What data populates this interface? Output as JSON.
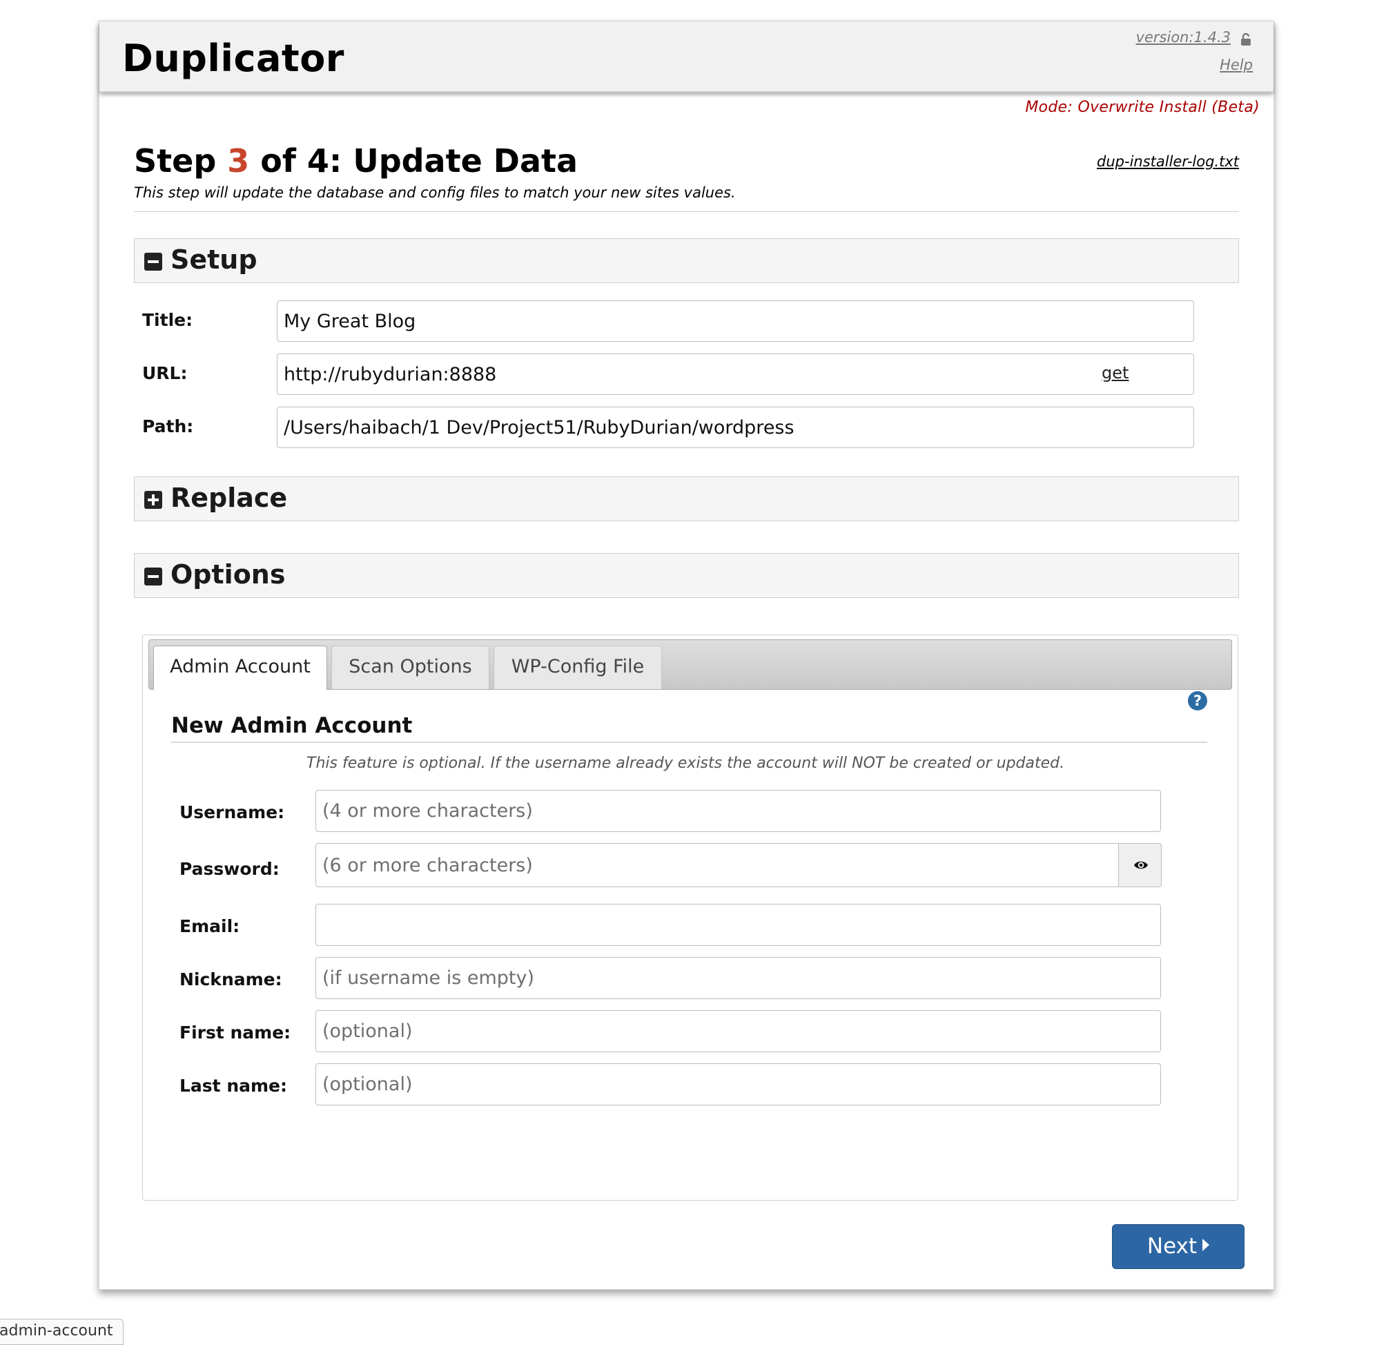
{
  "header": {
    "app_title": "Duplicator",
    "version": "version:1.4.3",
    "help": "Help",
    "mode": "Mode: Overwrite Install (Beta)"
  },
  "step": {
    "prefix": "Step ",
    "number": "3",
    "suffix": " of 4: Update Data",
    "description": "This step will update the database and config files to match your new sites values.",
    "log_link": "dup-installer-log.txt"
  },
  "setup": {
    "heading": "Setup",
    "title_label": "Title:",
    "title_value": "My Great Blog",
    "url_label": "URL:",
    "url_value": "http://rubydurian:8888",
    "get_link": "get",
    "path_label": "Path:",
    "path_value": "/Users/haibach/1 Dev/Project51/RubyDurian/wordpress"
  },
  "replace": {
    "heading": "Replace"
  },
  "options": {
    "heading": "Options",
    "tabs": [
      "Admin Account",
      "Scan Options",
      "WP-Config File"
    ],
    "active_tab": "Admin Account",
    "admin": {
      "heading": "New Admin Account",
      "note": "This feature is optional. If the username already exists the account will NOT be created or updated.",
      "username_label": "Username:",
      "username_placeholder": "(4 or more characters)",
      "password_label": "Password:",
      "password_placeholder": "(6 or more characters)",
      "email_label": "Email:",
      "email_placeholder": "",
      "nickname_label": "Nickname:",
      "nickname_placeholder": "(if username is empty)",
      "firstname_label": "First name:",
      "firstname_placeholder": "(optional)",
      "lastname_label": "Last name:",
      "lastname_placeholder": "(optional)"
    }
  },
  "footer": {
    "next_label": "Next",
    "status_tip": "admin-account"
  },
  "icons": {
    "lock": "lock-icon",
    "help": "question-circle-icon",
    "eye": "eye-icon",
    "collapse": "minus-square-icon",
    "expand": "plus-square-icon",
    "next": "caret-right-icon"
  },
  "colors": {
    "step_number": "#c8452d",
    "mode_text": "#aa0000",
    "next_button": "#2d66a4",
    "help_icon": "#2b6ca3"
  }
}
